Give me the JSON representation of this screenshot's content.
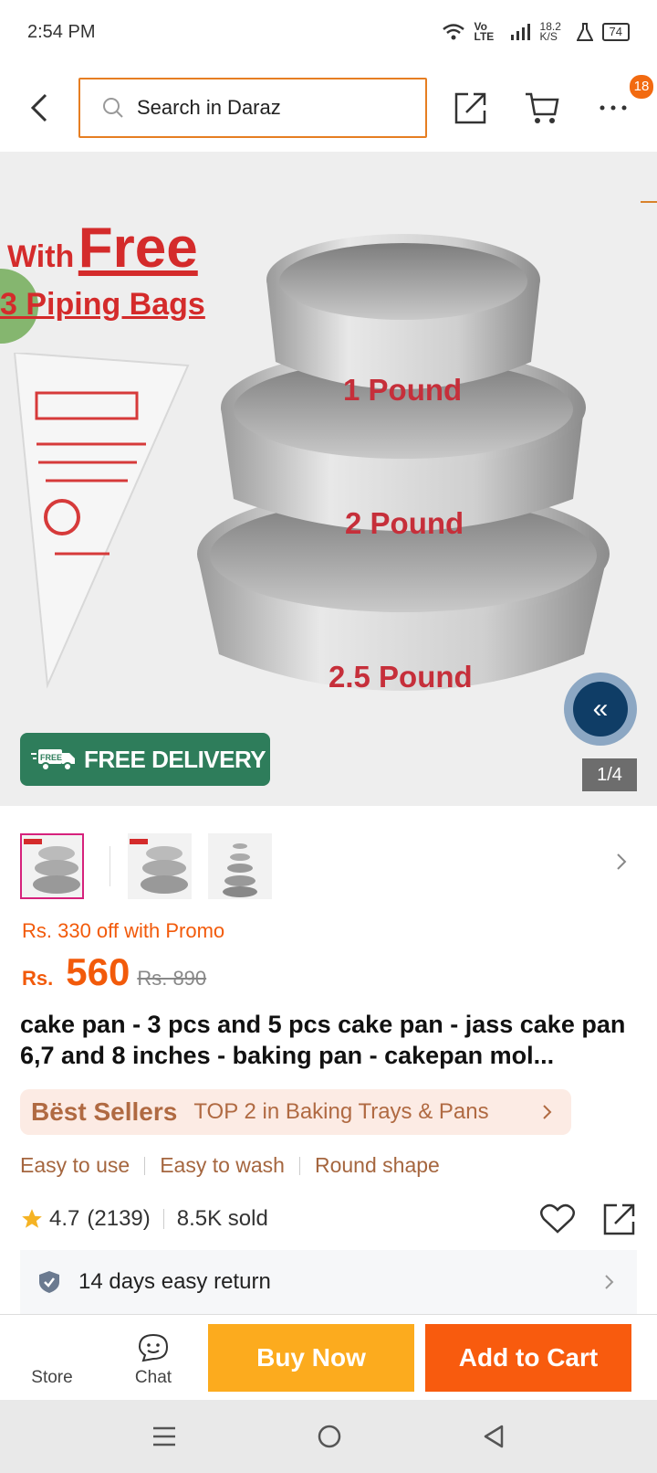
{
  "status_bar": {
    "time": "2:54 PM",
    "network_type": "Vo LTE",
    "speed": "18.2 K/S",
    "battery": "74"
  },
  "nav": {
    "search_placeholder": "Search in Daraz",
    "more_badge": "18"
  },
  "hero": {
    "with_text": "With",
    "free_text": "Free",
    "piping_text": "3 Piping Bags",
    "pan_labels": [
      "1 Pound",
      "2 Pound",
      "2.5 Pound"
    ],
    "free_delivery": "FREE DELIVERY",
    "free_tag": "FREE",
    "page_indicator": "1/4"
  },
  "price": {
    "promo": "Rs. 330 off with Promo",
    "currency": "Rs.",
    "current": "560",
    "original": "Rs. 890"
  },
  "product": {
    "title": "cake pan - 3 pcs and 5 pcs cake pan - jass cake pan 6,7 and 8 inches - baking pan - cakepan mol..."
  },
  "best_sellers": {
    "brand": "Bëst Sellers",
    "text": "TOP 2 in Baking Trays & Pans"
  },
  "tags": [
    "Easy to use",
    "Easy to wash",
    "Round shape"
  ],
  "rating": {
    "score": "4.7",
    "count": "(2139)",
    "sold": "8.5K sold"
  },
  "return_policy": "14 days easy return",
  "action_bar": {
    "store": "Store",
    "chat": "Chat",
    "buy_now": "Buy Now",
    "add_to_cart": "Add to Cart"
  },
  "colors": {
    "accent": "#f85b0e",
    "buy_now": "#fcab1e",
    "delivery": "#2e7d5b"
  }
}
